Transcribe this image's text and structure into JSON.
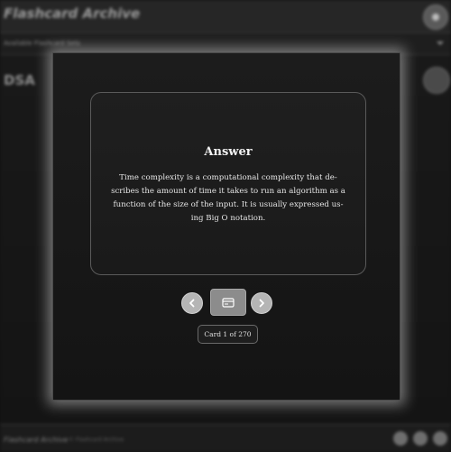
{
  "app": {
    "title": "Flashcard Archive",
    "deck_selector_label": "Available Flashcard Sets",
    "deck_title": "DSA"
  },
  "footer": {
    "brand": "Flashcard Archive",
    "credit": "© Flashcard Archive"
  },
  "card": {
    "heading": "Answer",
    "body": "Time complexity is a computational complexity that de-scribes the amount of time it takes to run an algorithm as a function of the size of the input. It is usually expressed us-ing Big O notation."
  },
  "navigation": {
    "prev_icon": "chevron-left-icon",
    "flip_icon": "card-flip-icon",
    "next_icon": "chevron-right-icon"
  },
  "counter": {
    "text": "Card 1 of 270"
  },
  "colors": {
    "modal_glow": "#ffffff",
    "nav_button": "#b5b5b5",
    "flip_button": "#8c8c8c",
    "text": "#f2f2f2"
  }
}
